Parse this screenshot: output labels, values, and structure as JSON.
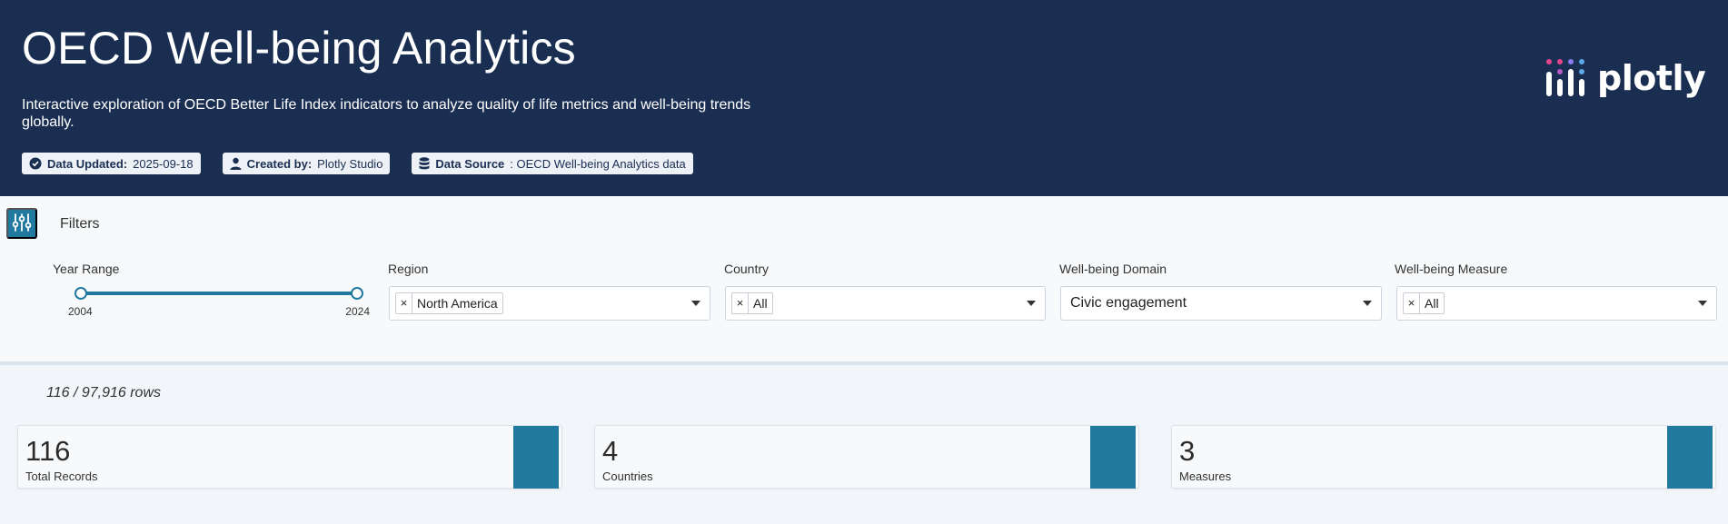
{
  "header": {
    "title": "OECD Well-being Analytics",
    "subtitle": "Interactive exploration of OECD Better Life Index indicators to analyze quality of life metrics and well-being trends globally.",
    "badges": [
      {
        "icon": "check-circle-icon",
        "key": "Data Updated:",
        "value": "2025-09-18"
      },
      {
        "icon": "user-icon",
        "key": "Created by:",
        "value": "Plotly Studio"
      },
      {
        "icon": "database-icon",
        "key": "Data Source",
        "value": ": OECD Well-being Analytics data"
      }
    ],
    "logo_text": "plotly"
  },
  "filters": {
    "label": "Filters",
    "toggle_icon": "sliders-icon",
    "year_range": {
      "label": "Year Range",
      "min": "2004",
      "max": "2024",
      "selected_min": 2004,
      "selected_max": 2024
    },
    "region": {
      "label": "Region",
      "selected": "North America"
    },
    "country": {
      "label": "Country",
      "selected": "All"
    },
    "domain": {
      "label": "Well-being Domain",
      "selected": "Civic engagement"
    },
    "measure": {
      "label": "Well-being Measure",
      "selected": "All"
    }
  },
  "row_count": "116 / 97,916 rows",
  "cards": [
    {
      "value": "116",
      "label": "Total Records"
    },
    {
      "value": "4",
      "label": "Countries"
    },
    {
      "value": "3",
      "label": "Measures"
    }
  ],
  "colors": {
    "header_bg": "#1a2e52",
    "accent": "#21799f"
  }
}
